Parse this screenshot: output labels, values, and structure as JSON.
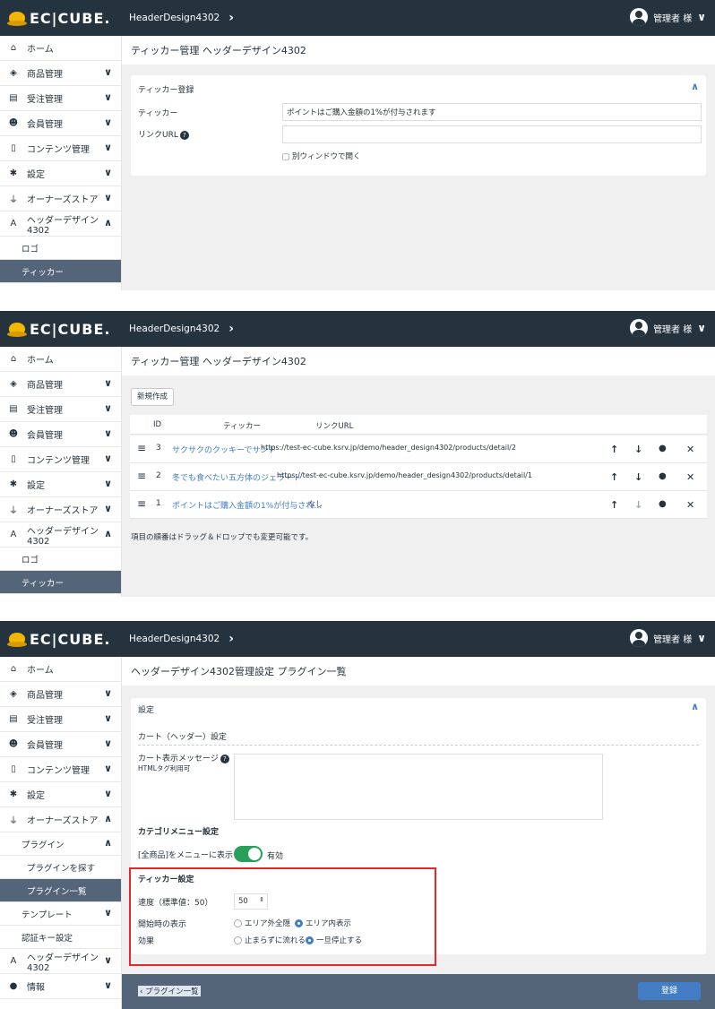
{
  "brand": "EC|CUBE.",
  "header": {
    "breadcrumb": "HeaderDesign4302",
    "user": "管理者 様"
  },
  "sidebar1": {
    "items": [
      {
        "icon": "home-icon",
        "glyph": "⌂",
        "label": "ホーム",
        "arrow": ""
      },
      {
        "icon": "cube-icon",
        "glyph": "◈",
        "label": "商品管理",
        "arrow": "∨"
      },
      {
        "icon": "cart-icon",
        "glyph": "▤",
        "label": "受注管理",
        "arrow": "∨"
      },
      {
        "icon": "users-icon",
        "glyph": "☻",
        "label": "会員管理",
        "arrow": "∨"
      },
      {
        "icon": "file-icon",
        "glyph": "▯",
        "label": "コンテンツ管理",
        "arrow": "∨"
      },
      {
        "icon": "gear-icon",
        "glyph": "✱",
        "label": "設定",
        "arrow": "∨"
      },
      {
        "icon": "plug-icon",
        "glyph": "⏚",
        "label": "オーナーズストア",
        "arrow": "∨"
      },
      {
        "icon": "design-icon",
        "glyph": "A",
        "label": "ヘッダーデザイン4302",
        "arrow": "∧"
      }
    ],
    "subs": [
      {
        "label": "ロゴ",
        "selected": false
      },
      {
        "label": "ティッカー",
        "selected": true
      }
    ]
  },
  "panel1": {
    "title": "ティッカー管理 ヘッダーデザイン4302",
    "card_title": "ティッカー登録",
    "ticker_label": "ティッカー",
    "ticker_value": "ポイントはご購入金額の1%が付与されます",
    "link_label": "リンクURL",
    "newwin_label": "別ウィンドウで開く"
  },
  "panel2": {
    "title": "ティッカー管理 ヘッダーデザイン4302",
    "new_button": "新規作成",
    "columns": [
      "ID",
      "ティッカー",
      "リンクURL"
    ],
    "rows": [
      {
        "id": "3",
        "ticker": "サクサクのクッキーでサンド",
        "url": "https://test-ec-cube.ksrv.jp/demo/header_design4302/products/detail/2"
      },
      {
        "id": "2",
        "ticker": "冬でも食べたい五方体のジェラート",
        "url": "https://test-ec-cube.ksrv.jp/demo/header_design4302/products/detail/1"
      },
      {
        "id": "1",
        "ticker": "ポイントはご購入金額の1%が付与され…",
        "url": "なし"
      }
    ],
    "note": "項目の順番はドラッグ＆ドロップでも変更可能です。"
  },
  "sidebar3": {
    "items": [
      {
        "icon": "home-icon",
        "glyph": "⌂",
        "label": "ホーム",
        "arrow": ""
      },
      {
        "icon": "cube-icon",
        "glyph": "◈",
        "label": "商品管理",
        "arrow": "∨"
      },
      {
        "icon": "cart-icon",
        "glyph": "▤",
        "label": "受注管理",
        "arrow": "∨"
      },
      {
        "icon": "users-icon",
        "glyph": "☻",
        "label": "会員管理",
        "arrow": "∨"
      },
      {
        "icon": "file-icon",
        "glyph": "▯",
        "label": "コンテンツ管理",
        "arrow": "∨"
      },
      {
        "icon": "gear-icon",
        "glyph": "✱",
        "label": "設定",
        "arrow": "∨"
      },
      {
        "icon": "plug-icon",
        "glyph": "⏚",
        "label": "オーナーズストア",
        "arrow": "∧"
      }
    ],
    "plugin": "プラグイン",
    "plugin_subs": [
      {
        "label": "プラグインを探す",
        "selected": false
      },
      {
        "label": "プラグイン一覧",
        "selected": true
      }
    ],
    "template": "テンプレート",
    "auth": "認証キー設定",
    "design": "ヘッダーデザイン4302",
    "info": "情報"
  },
  "panel3": {
    "title": "ヘッダーデザイン4302管理設定 プラグイン一覧",
    "card_title": "設定",
    "cart_section": "カート（ヘッダー）設定",
    "cart_msg_label": "カート表示メッセージ",
    "cart_msg_sub": "HTMLタグ利用可",
    "cat_section": "カテゴリメニュー設定",
    "cat_label": "[全商品]をメニューに表示",
    "cat_toggle": "有効",
    "ticker_section": "ティッカー設定",
    "speed_label": "速度（標準値：50）",
    "speed_value": "50",
    "start_label": "開始時の表示",
    "start_opt1": "エリア外全隠",
    "start_opt2": "エリア内表示",
    "effect_label": "効果",
    "effect_opt1": "止まらずに流れる",
    "effect_opt2": "一旦停止する",
    "back_link": "プラグイン一覧",
    "save_button": "登録",
    "highlight_color": "#e8262b"
  }
}
